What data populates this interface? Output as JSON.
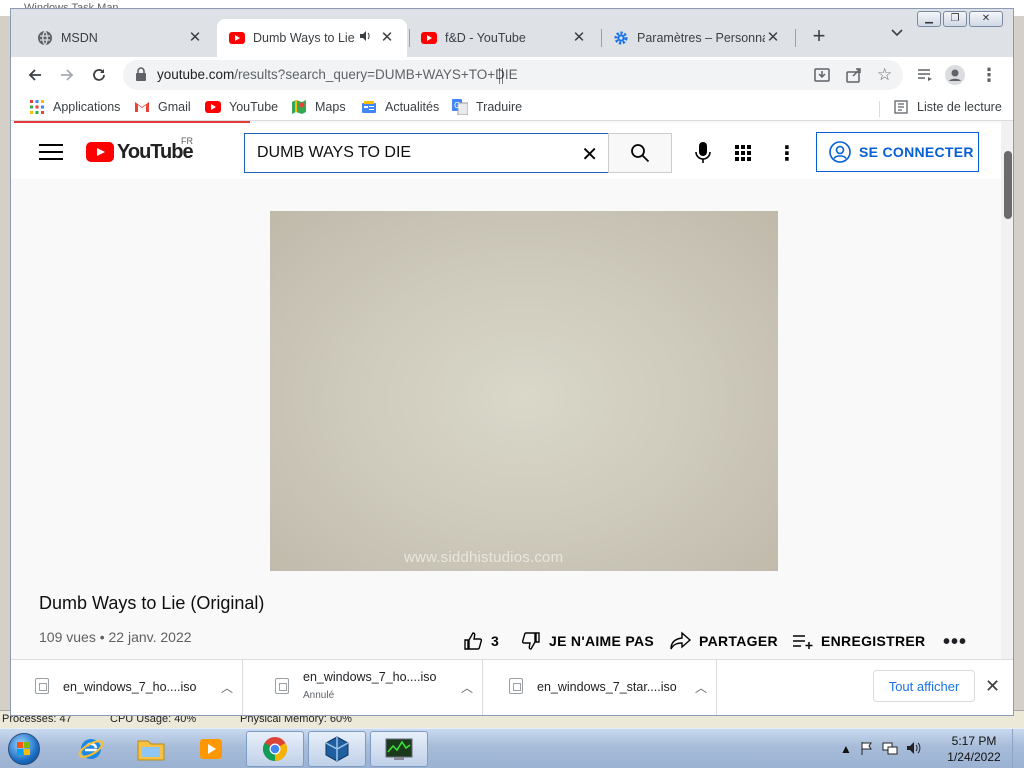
{
  "background_window": {
    "title": "Windows Task Man",
    "status": {
      "processes": "Processes: 47",
      "cpu": "CPU Usage: 40%",
      "memory": "Physical Memory: 60%"
    }
  },
  "browser": {
    "tabs": [
      {
        "label": "MSDN",
        "icon": "globe-icon",
        "active": false
      },
      {
        "label": "Dumb Ways to Lie (",
        "icon": "youtube-icon",
        "active": true,
        "audio": true
      },
      {
        "label": "f&D - YouTube",
        "icon": "youtube-icon",
        "active": false
      },
      {
        "label": "Paramètres – Personnali",
        "icon": "settings-gear-icon",
        "active": false
      }
    ],
    "url_host": "youtube.com",
    "url_rest": "/results?search_query=DUMB+WAYS+TO+DIE",
    "bookmarks": [
      {
        "label": "Applications",
        "icon": "apps-grid-icon"
      },
      {
        "label": "Gmail",
        "icon": "gmail-icon"
      },
      {
        "label": "YouTube",
        "icon": "youtube-icon"
      },
      {
        "label": "Maps",
        "icon": "maps-icon"
      },
      {
        "label": "Actualités",
        "icon": "news-icon"
      },
      {
        "label": "Traduire",
        "icon": "translate-icon"
      }
    ],
    "reading_list": "Liste de lecture"
  },
  "youtube": {
    "country": "FR",
    "logo_text": "YouTube",
    "search_query": "DUMB WAYS TO DIE",
    "signin_label": "SE CONNECTER",
    "video": {
      "watermark": "www.siddhistudios.com",
      "title": "Dumb Ways to Lie (Original)",
      "meta": "109 vues • 22 janv. 2022",
      "likes": "3",
      "dislike_label": "JE N'AIME PAS",
      "share_label": "PARTAGER",
      "save_label": "ENREGISTRER"
    }
  },
  "downloads": {
    "items": [
      {
        "name": "en_windows_7_ho....iso",
        "status": ""
      },
      {
        "name": "en_windows_7_ho....iso",
        "status": "Annulé"
      },
      {
        "name": "en_windows_7_star....iso",
        "status": ""
      }
    ],
    "show_all": "Tout afficher"
  },
  "taskbar": {
    "time": "5:17 PM",
    "date": "1/24/2022"
  },
  "colors": {
    "youtube_red": "#ff0000",
    "link_blue": "#065fd4",
    "chrome_tabstrip": "#dee1e6"
  }
}
